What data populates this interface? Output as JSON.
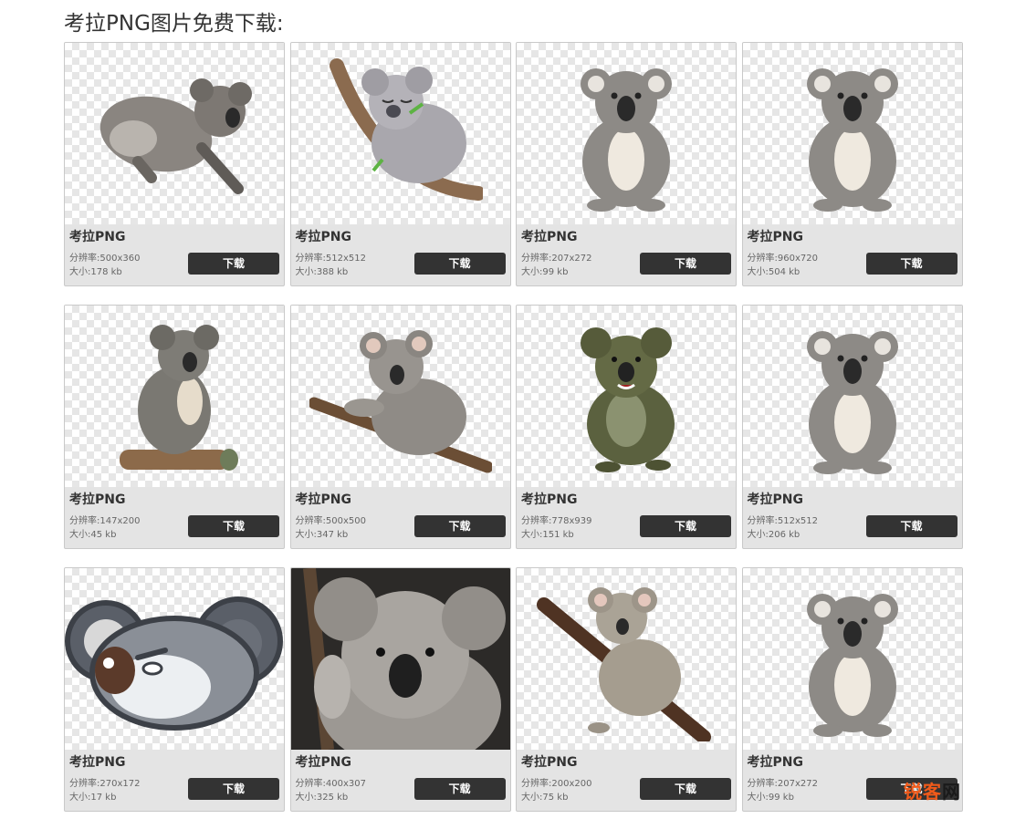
{
  "page": {
    "heading": "考拉PNG图片免费下载:"
  },
  "labels": {
    "resolution_prefix": "分辨率:",
    "size_prefix": "大小:"
  },
  "cards": [
    {
      "title": "考拉PNG",
      "resolution": "500x360",
      "size": "178 kb",
      "button": "下载",
      "art": "koala-lying-icon"
    },
    {
      "title": "考拉PNG",
      "resolution": "512x512",
      "size": "388 kb",
      "button": "下载",
      "art": "koala-sleeping-branch-icon"
    },
    {
      "title": "考拉PNG",
      "resolution": "207x272",
      "size": "99 kb",
      "button": "下载",
      "art": "koala-sitting-icon"
    },
    {
      "title": "考拉PNG",
      "resolution": "960x720",
      "size": "504 kb",
      "button": "下载",
      "art": "koala-sitting-icon"
    },
    {
      "title": "考拉PNG",
      "resolution": "147x200",
      "size": "45 kb",
      "button": "下载",
      "art": "koala-on-log-icon"
    },
    {
      "title": "考拉PNG",
      "resolution": "500x500",
      "size": "347 kb",
      "button": "下载",
      "art": "koala-on-branch-icon"
    },
    {
      "title": "考拉PNG",
      "resolution": "778x939",
      "size": "151 kb",
      "button": "下载",
      "art": "koala-cartoon-icon"
    },
    {
      "title": "考拉PNG",
      "resolution": "512x512",
      "size": "206 kb",
      "button": "下载",
      "art": "koala-sitting-icon"
    },
    {
      "title": "考拉PNG",
      "resolution": "270x172",
      "size": "17 kb",
      "button": "下载",
      "art": "koala-mascot-head-icon"
    },
    {
      "title": "考拉PNG",
      "resolution": "400x307",
      "size": "325 kb",
      "button": "下载",
      "art": "koala-closeup-icon"
    },
    {
      "title": "考拉PNG",
      "resolution": "200x200",
      "size": "75 kb",
      "button": "下载",
      "art": "koala-climbing-icon"
    },
    {
      "title": "考拉PNG",
      "resolution": "207x272",
      "size": "99 kb",
      "button": "下载",
      "art": "koala-sitting-icon"
    }
  ],
  "watermark": {
    "part1": "锐客",
    "part2": "网"
  },
  "colors": {
    "button_bg": "#333333",
    "card_bg": "#e4e4e4",
    "watermark_accent": "#f05a1a"
  }
}
